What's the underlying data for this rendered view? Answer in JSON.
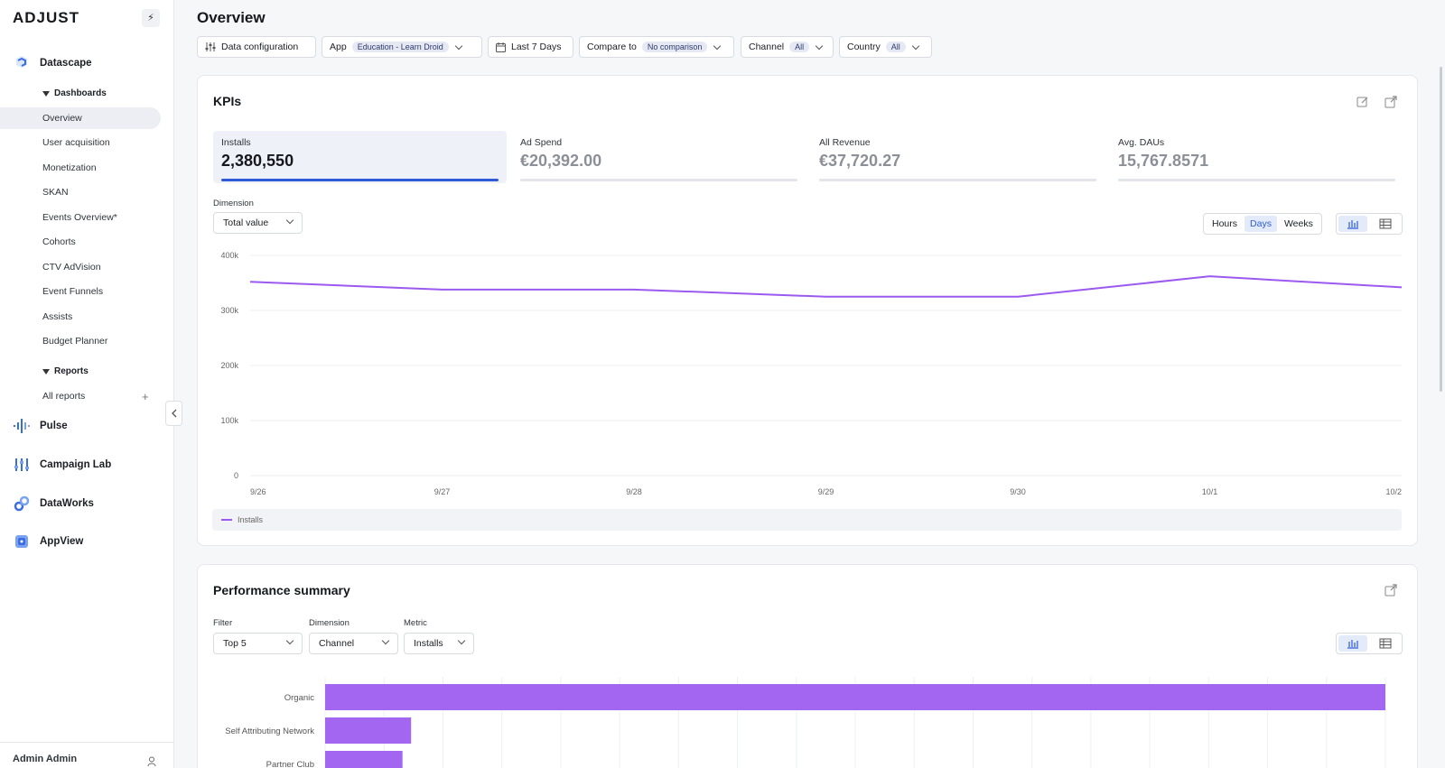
{
  "brand": {
    "logo": "ADJUST",
    "accent": "#2f5bd6",
    "chart_color": "#9b59f0"
  },
  "sidebar": {
    "toggle_glyph": "⚡",
    "sections": [
      {
        "label": "Datascape",
        "icon": "datascape-icon"
      },
      {
        "label": "Pulse",
        "icon": "pulse-icon"
      },
      {
        "label": "Campaign Lab",
        "icon": "campaign-lab-icon"
      },
      {
        "label": "DataWorks",
        "icon": "dataworks-icon"
      },
      {
        "label": "AppView",
        "icon": "appview-icon"
      }
    ],
    "groups": {
      "dashboards": "Dashboards",
      "reports": "Reports"
    },
    "dashboard_items": [
      "Overview",
      "User acquisition",
      "Monetization",
      "SKAN",
      "Events Overview*",
      "Cohorts",
      "CTV AdVision",
      "Event Funnels",
      "Assists",
      "Budget Planner"
    ],
    "report_items": [
      "All reports"
    ],
    "add_glyph": "+",
    "user": "Admin Admin"
  },
  "header": {
    "title": "Overview",
    "filters": {
      "data_config": "Data configuration",
      "app_label": "App",
      "app_value": "Education - Learn Droid",
      "date_range": "Last 7 Days",
      "compare_label": "Compare to",
      "compare_value": "No comparison",
      "channel_label": "Channel",
      "channel_value": "All",
      "country_label": "Country",
      "country_value": "All"
    }
  },
  "kpis": {
    "title": "KPIs",
    "items": [
      {
        "label": "Installs",
        "value": "2,380,550"
      },
      {
        "label": "Ad Spend",
        "value": "€20,392.00"
      },
      {
        "label": "All Revenue",
        "value": "€37,720.27"
      },
      {
        "label": "Avg. DAUs",
        "value": "15,767.8571"
      }
    ],
    "dimension_label": "Dimension",
    "dimension_value": "Total value",
    "granularity": [
      "Hours",
      "Days",
      "Weeks"
    ],
    "granularity_selected": "Days"
  },
  "chart_data": [
    {
      "type": "line",
      "x": [
        "9/26",
        "9/27",
        "9/28",
        "9/29",
        "9/30",
        "10/1",
        "10/2"
      ],
      "series": [
        {
          "name": "Installs",
          "values": [
            352000,
            338000,
            338000,
            325000,
            325000,
            362000,
            342000
          ]
        }
      ],
      "yticks": [
        "0",
        "100k",
        "200k",
        "300k",
        "400k"
      ],
      "ylim": [
        0,
        400000
      ],
      "grid": true,
      "legend": "bottom"
    },
    {
      "type": "bar",
      "orientation": "horizontal",
      "categories": [
        "Organic",
        "Self Attributing Network",
        "Partner Club"
      ],
      "values": [
        1850000,
        150000,
        135000
      ]
    }
  ],
  "performance": {
    "title": "Performance summary",
    "filter_label": "Filter",
    "filter_value": "Top 5",
    "dimension_label": "Dimension",
    "dimension_value": "Channel",
    "metric_label": "Metric",
    "metric_value": "Installs"
  }
}
